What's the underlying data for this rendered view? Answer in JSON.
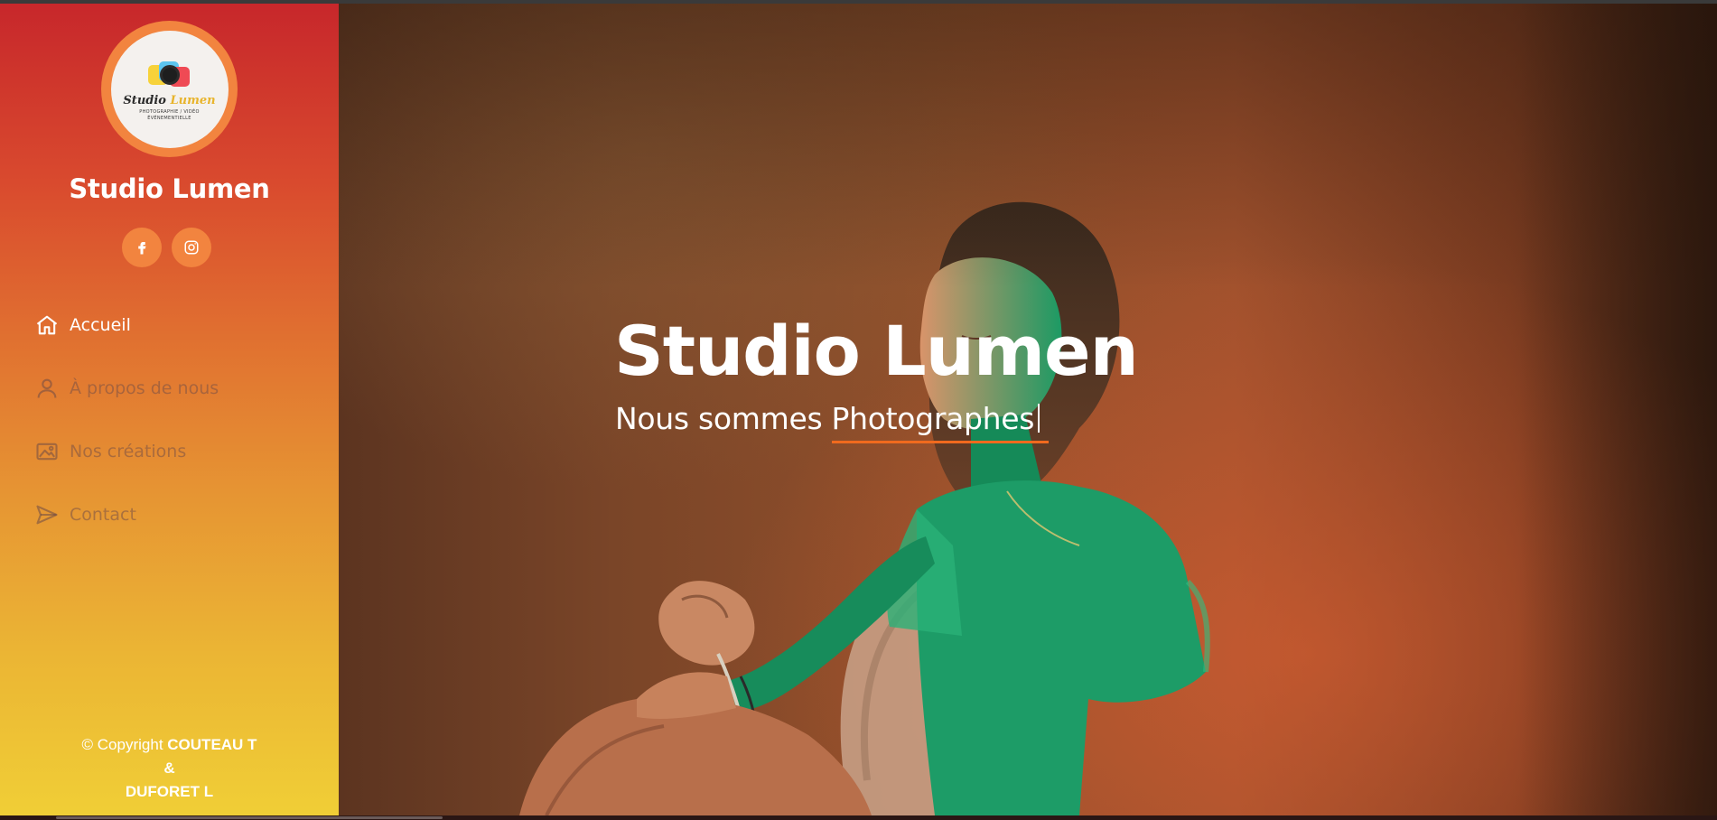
{
  "sidebar": {
    "logo": {
      "name_part1": "Studio",
      "name_part2": "Lumen",
      "tagline_line1": "PHOTOGRAPHIE / VIDÉO",
      "tagline_line2": "ÉVÉNEMENTIELLE"
    },
    "title": "Studio Lumen",
    "social": [
      {
        "icon": "facebook-icon"
      },
      {
        "icon": "instagram-icon"
      }
    ],
    "nav": [
      {
        "label": "Accueil",
        "icon": "home-icon",
        "active": true
      },
      {
        "label": "À propos de nous",
        "icon": "user-icon",
        "active": false
      },
      {
        "label": "Nos créations",
        "icon": "image-icon",
        "active": false
      },
      {
        "label": "Contact",
        "icon": "send-icon",
        "active": false
      }
    ],
    "copyright": {
      "prefix": "© Copyright",
      "author1": "COUTEAU T",
      "amp": "&",
      "author2": "DUFORET L"
    }
  },
  "hero": {
    "title": "Studio Lumen",
    "subtitle_prefix": "Nous sommes",
    "subtitle_typed": "Photographes"
  },
  "colors": {
    "sidebar_top": "#c7272b",
    "sidebar_bottom": "#f0ce36",
    "accent": "#f2843f",
    "underline": "#f06a1e"
  }
}
